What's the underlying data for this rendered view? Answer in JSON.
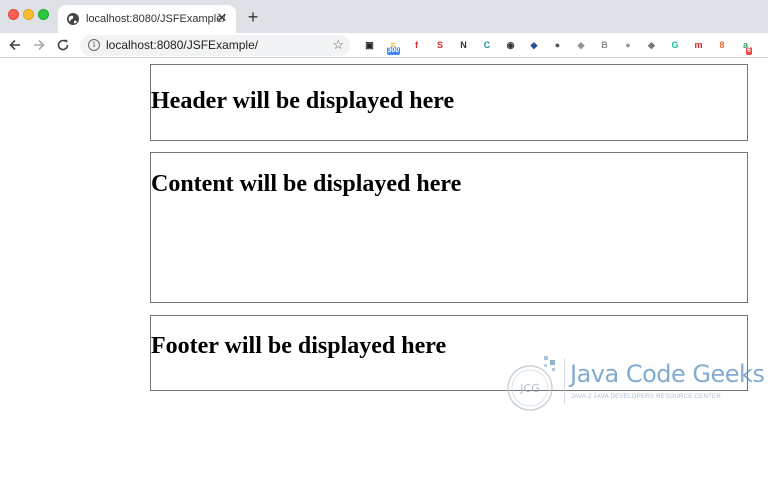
{
  "browser": {
    "tab_title": "localhost:8080/JSFExample/",
    "tab_close": "✕",
    "new_tab": "+",
    "url": "localhost:8080/JSFExample/",
    "extensions": [
      {
        "name": "extension-icon-1",
        "glyph": "▣",
        "color": "#222222"
      },
      {
        "name": "rss-extension-icon",
        "glyph": "≡",
        "color": "#f7a21b",
        "badge": "300"
      },
      {
        "name": "flipboard-extension-icon",
        "glyph": "f",
        "color": "#e12828"
      },
      {
        "name": "extension-icon-s",
        "glyph": "S",
        "color": "#d32d2d"
      },
      {
        "name": "notion-extension-icon",
        "glyph": "N",
        "color": "#333333"
      },
      {
        "name": "extension-icon-c",
        "glyph": "C",
        "color": "#1a8fa8"
      },
      {
        "name": "audio-extension-icon",
        "glyph": "◉",
        "color": "#333333"
      },
      {
        "name": "extension-icon-globe",
        "glyph": "◆",
        "color": "#2a4f9c"
      },
      {
        "name": "extension-icon-circle",
        "glyph": "●",
        "color": "#555555"
      },
      {
        "name": "dropbox-extension-icon",
        "glyph": "◈",
        "color": "#8d8d8d"
      },
      {
        "name": "extension-icon-b",
        "glyph": "B",
        "color": "#8d8d8d"
      },
      {
        "name": "extension-icon-gray",
        "glyph": "●",
        "color": "#999999"
      },
      {
        "name": "extension-icon-shield",
        "glyph": "◆",
        "color": "#777777"
      },
      {
        "name": "grammarly-extension-icon",
        "glyph": "G",
        "color": "#15c39a"
      },
      {
        "name": "extension-icon-m",
        "glyph": "m",
        "color": "#d8232a"
      },
      {
        "name": "extension-icon-8",
        "glyph": "8",
        "color": "#e8632b"
      },
      {
        "name": "extension-icon-a",
        "glyph": "a",
        "color": "#27a567",
        "badge": "6"
      }
    ]
  },
  "page": {
    "header_text": "Header will be displayed here",
    "content_text": "Content will be displayed here",
    "footer_text": "Footer will be displayed here"
  },
  "watermark": {
    "logo_initials": "JCG",
    "brand": "Java Code Geeks",
    "tagline": "JAVA 2 JAVA DEVELOPERS RESOURCE CENTER"
  }
}
